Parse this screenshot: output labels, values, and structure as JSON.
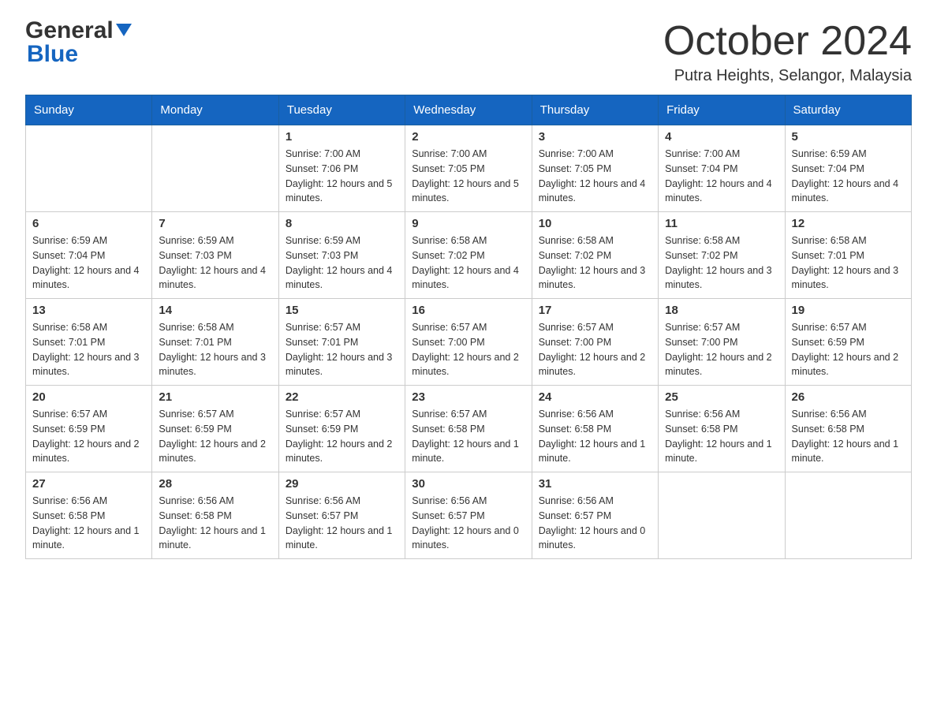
{
  "header": {
    "month_title": "October 2024",
    "location": "Putra Heights, Selangor, Malaysia",
    "logo_general": "General",
    "logo_blue": "Blue"
  },
  "days_of_week": [
    "Sunday",
    "Monday",
    "Tuesday",
    "Wednesday",
    "Thursday",
    "Friday",
    "Saturday"
  ],
  "weeks": [
    [
      {
        "day": "",
        "sunrise": "",
        "sunset": "",
        "daylight": ""
      },
      {
        "day": "",
        "sunrise": "",
        "sunset": "",
        "daylight": ""
      },
      {
        "day": "1",
        "sunrise": "Sunrise: 7:00 AM",
        "sunset": "Sunset: 7:06 PM",
        "daylight": "Daylight: 12 hours and 5 minutes."
      },
      {
        "day": "2",
        "sunrise": "Sunrise: 7:00 AM",
        "sunset": "Sunset: 7:05 PM",
        "daylight": "Daylight: 12 hours and 5 minutes."
      },
      {
        "day": "3",
        "sunrise": "Sunrise: 7:00 AM",
        "sunset": "Sunset: 7:05 PM",
        "daylight": "Daylight: 12 hours and 4 minutes."
      },
      {
        "day": "4",
        "sunrise": "Sunrise: 7:00 AM",
        "sunset": "Sunset: 7:04 PM",
        "daylight": "Daylight: 12 hours and 4 minutes."
      },
      {
        "day": "5",
        "sunrise": "Sunrise: 6:59 AM",
        "sunset": "Sunset: 7:04 PM",
        "daylight": "Daylight: 12 hours and 4 minutes."
      }
    ],
    [
      {
        "day": "6",
        "sunrise": "Sunrise: 6:59 AM",
        "sunset": "Sunset: 7:04 PM",
        "daylight": "Daylight: 12 hours and 4 minutes."
      },
      {
        "day": "7",
        "sunrise": "Sunrise: 6:59 AM",
        "sunset": "Sunset: 7:03 PM",
        "daylight": "Daylight: 12 hours and 4 minutes."
      },
      {
        "day": "8",
        "sunrise": "Sunrise: 6:59 AM",
        "sunset": "Sunset: 7:03 PM",
        "daylight": "Daylight: 12 hours and 4 minutes."
      },
      {
        "day": "9",
        "sunrise": "Sunrise: 6:58 AM",
        "sunset": "Sunset: 7:02 PM",
        "daylight": "Daylight: 12 hours and 4 minutes."
      },
      {
        "day": "10",
        "sunrise": "Sunrise: 6:58 AM",
        "sunset": "Sunset: 7:02 PM",
        "daylight": "Daylight: 12 hours and 3 minutes."
      },
      {
        "day": "11",
        "sunrise": "Sunrise: 6:58 AM",
        "sunset": "Sunset: 7:02 PM",
        "daylight": "Daylight: 12 hours and 3 minutes."
      },
      {
        "day": "12",
        "sunrise": "Sunrise: 6:58 AM",
        "sunset": "Sunset: 7:01 PM",
        "daylight": "Daylight: 12 hours and 3 minutes."
      }
    ],
    [
      {
        "day": "13",
        "sunrise": "Sunrise: 6:58 AM",
        "sunset": "Sunset: 7:01 PM",
        "daylight": "Daylight: 12 hours and 3 minutes."
      },
      {
        "day": "14",
        "sunrise": "Sunrise: 6:58 AM",
        "sunset": "Sunset: 7:01 PM",
        "daylight": "Daylight: 12 hours and 3 minutes."
      },
      {
        "day": "15",
        "sunrise": "Sunrise: 6:57 AM",
        "sunset": "Sunset: 7:01 PM",
        "daylight": "Daylight: 12 hours and 3 minutes."
      },
      {
        "day": "16",
        "sunrise": "Sunrise: 6:57 AM",
        "sunset": "Sunset: 7:00 PM",
        "daylight": "Daylight: 12 hours and 2 minutes."
      },
      {
        "day": "17",
        "sunrise": "Sunrise: 6:57 AM",
        "sunset": "Sunset: 7:00 PM",
        "daylight": "Daylight: 12 hours and 2 minutes."
      },
      {
        "day": "18",
        "sunrise": "Sunrise: 6:57 AM",
        "sunset": "Sunset: 7:00 PM",
        "daylight": "Daylight: 12 hours and 2 minutes."
      },
      {
        "day": "19",
        "sunrise": "Sunrise: 6:57 AM",
        "sunset": "Sunset: 6:59 PM",
        "daylight": "Daylight: 12 hours and 2 minutes."
      }
    ],
    [
      {
        "day": "20",
        "sunrise": "Sunrise: 6:57 AM",
        "sunset": "Sunset: 6:59 PM",
        "daylight": "Daylight: 12 hours and 2 minutes."
      },
      {
        "day": "21",
        "sunrise": "Sunrise: 6:57 AM",
        "sunset": "Sunset: 6:59 PM",
        "daylight": "Daylight: 12 hours and 2 minutes."
      },
      {
        "day": "22",
        "sunrise": "Sunrise: 6:57 AM",
        "sunset": "Sunset: 6:59 PM",
        "daylight": "Daylight: 12 hours and 2 minutes."
      },
      {
        "day": "23",
        "sunrise": "Sunrise: 6:57 AM",
        "sunset": "Sunset: 6:58 PM",
        "daylight": "Daylight: 12 hours and 1 minute."
      },
      {
        "day": "24",
        "sunrise": "Sunrise: 6:56 AM",
        "sunset": "Sunset: 6:58 PM",
        "daylight": "Daylight: 12 hours and 1 minute."
      },
      {
        "day": "25",
        "sunrise": "Sunrise: 6:56 AM",
        "sunset": "Sunset: 6:58 PM",
        "daylight": "Daylight: 12 hours and 1 minute."
      },
      {
        "day": "26",
        "sunrise": "Sunrise: 6:56 AM",
        "sunset": "Sunset: 6:58 PM",
        "daylight": "Daylight: 12 hours and 1 minute."
      }
    ],
    [
      {
        "day": "27",
        "sunrise": "Sunrise: 6:56 AM",
        "sunset": "Sunset: 6:58 PM",
        "daylight": "Daylight: 12 hours and 1 minute."
      },
      {
        "day": "28",
        "sunrise": "Sunrise: 6:56 AM",
        "sunset": "Sunset: 6:58 PM",
        "daylight": "Daylight: 12 hours and 1 minute."
      },
      {
        "day": "29",
        "sunrise": "Sunrise: 6:56 AM",
        "sunset": "Sunset: 6:57 PM",
        "daylight": "Daylight: 12 hours and 1 minute."
      },
      {
        "day": "30",
        "sunrise": "Sunrise: 6:56 AM",
        "sunset": "Sunset: 6:57 PM",
        "daylight": "Daylight: 12 hours and 0 minutes."
      },
      {
        "day": "31",
        "sunrise": "Sunrise: 6:56 AM",
        "sunset": "Sunset: 6:57 PM",
        "daylight": "Daylight: 12 hours and 0 minutes."
      },
      {
        "day": "",
        "sunrise": "",
        "sunset": "",
        "daylight": ""
      },
      {
        "day": "",
        "sunrise": "",
        "sunset": "",
        "daylight": ""
      }
    ]
  ]
}
